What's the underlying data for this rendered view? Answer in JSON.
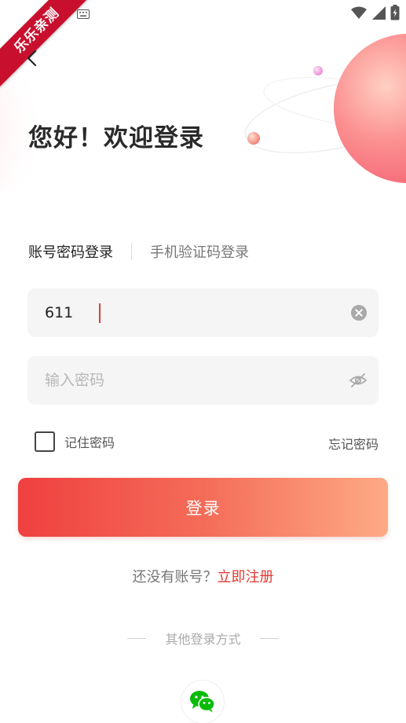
{
  "watermark": {
    "text": "乐乐亲测"
  },
  "header": {
    "title": "您好！欢迎登录"
  },
  "tabs": [
    {
      "label": "账号密码登录",
      "active": true
    },
    {
      "label": "手机验证码登录",
      "active": false
    }
  ],
  "account": {
    "value": "611",
    "clear_icon": "clear-circle-icon"
  },
  "password": {
    "placeholder": "输入密码",
    "toggle_icon": "eye-off-icon"
  },
  "remember": {
    "label": "记住密码",
    "checked": false
  },
  "forgot": {
    "label": "忘记密码"
  },
  "login_button": {
    "label": "登录"
  },
  "register": {
    "question": "还没有账号？",
    "link": "立即注册"
  },
  "other_login": {
    "label": "其他登录方式",
    "wechat_icon": "wechat-icon"
  },
  "colors": {
    "accent": "#e53935",
    "gradient_start": "#ef4040",
    "gradient_end": "#fdaa85"
  }
}
